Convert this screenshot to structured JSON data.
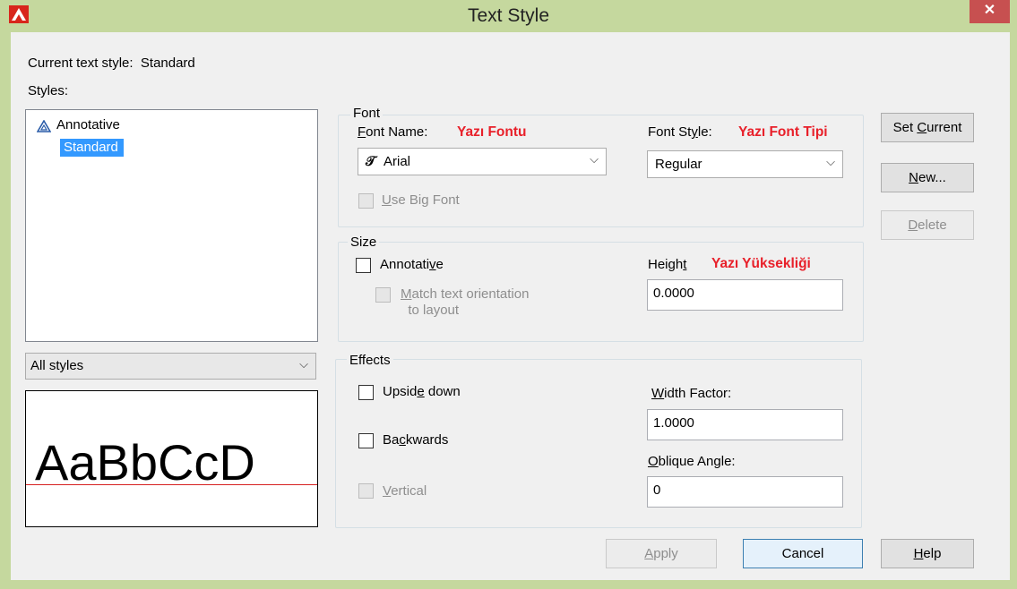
{
  "window": {
    "title": "Text Style",
    "close_symbol": "✕"
  },
  "current_style": {
    "label": "Current text style:",
    "value": "Standard"
  },
  "styles": {
    "label": "Styles:",
    "items": [
      {
        "label": "Annotative",
        "icon": "annotative-icon"
      },
      {
        "label": "Standard",
        "selected": true
      }
    ],
    "filter": {
      "value": "All styles"
    },
    "preview_text": "AaBbCcD"
  },
  "font": {
    "group_title": "Font",
    "font_name_label": "Font Name:",
    "font_name_note": "Yazı Fontu",
    "font_name_value": "Arial",
    "font_style_label": "Font Style:",
    "font_style_note": "Yazı Font Tipi",
    "font_style_value": "Regular",
    "use_big_font": "Use Big Font"
  },
  "size": {
    "group_title": "Size",
    "annotative": "Annotative",
    "match_line1": "Match text orientation",
    "match_line2": "to layout",
    "height_label": "Height",
    "height_note": "Yazı Yüksekliği",
    "height_value": "0.0000"
  },
  "effects": {
    "group_title": "Effects",
    "upside_down": "Upside down",
    "backwards": "Backwards",
    "vertical": "Vertical",
    "width_factor_label": "Width Factor:",
    "width_factor_value": "1.0000",
    "oblique_label": "Oblique Angle:",
    "oblique_value": "0"
  },
  "buttons": {
    "set_current": "Set Current",
    "new": "New...",
    "delete": "Delete",
    "apply": "Apply",
    "cancel": "Cancel",
    "help": "Help"
  }
}
